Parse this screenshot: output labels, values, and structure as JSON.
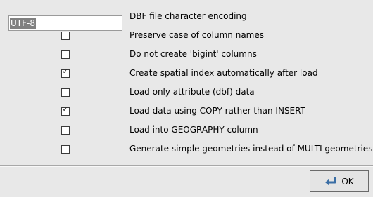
{
  "encoding": {
    "value": "UTF-8",
    "label": "DBF file character encoding"
  },
  "options": [
    {
      "label": "Preserve case of column names",
      "checked": false
    },
    {
      "label": "Do not create 'bigint' columns",
      "checked": false
    },
    {
      "label": "Create spatial index automatically after load",
      "checked": true
    },
    {
      "label": "Load only attribute (dbf) data",
      "checked": false
    },
    {
      "label": "Load data using COPY rather than INSERT",
      "checked": true
    },
    {
      "label": "Load into GEOGRAPHY column",
      "checked": false
    },
    {
      "label": "Generate simple geometries instead of MULTI geometries",
      "checked": false
    }
  ],
  "footer": {
    "ok_label": "OK",
    "ok_icon": "enter-arrow-icon"
  },
  "check_glyph": "✓"
}
